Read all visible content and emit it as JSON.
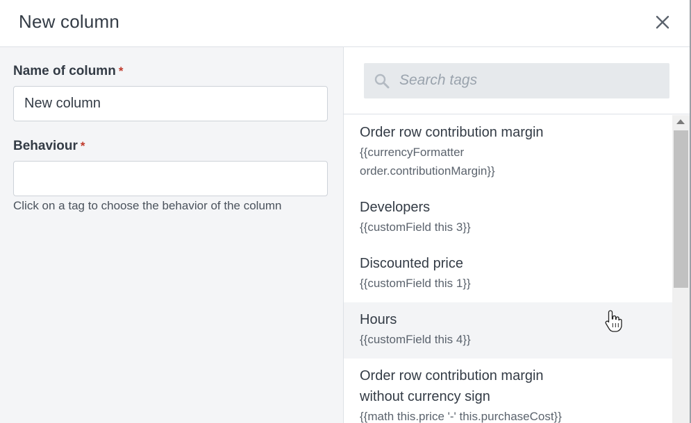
{
  "dialog": {
    "title": "New column",
    "close_icon": "close-icon"
  },
  "form": {
    "name_label": "Name of column",
    "name_required": "*",
    "name_value": "New column",
    "behaviour_label": "Behaviour",
    "behaviour_required": "*",
    "behaviour_value": "",
    "help_text": "Click on a tag to choose the behavior of the column"
  },
  "search": {
    "icon": "search-icon",
    "placeholder": "Search tags"
  },
  "tags": [
    {
      "name": "Order row contribution margin",
      "code_lines": [
        "{{currencyFormatter",
        "order.contributionMargin}}"
      ]
    },
    {
      "name": "Developers",
      "code_lines": [
        "{{customField this 3}}"
      ]
    },
    {
      "name": "Discounted price",
      "code_lines": [
        "{{customField this 1}}"
      ]
    },
    {
      "name": "Hours",
      "code_lines": [
        "{{customField this 4}}"
      ]
    },
    {
      "name": "Order row contribution margin without currency sign",
      "name_lines": [
        "Order row contribution margin",
        "without currency sign"
      ],
      "code_lines": [
        "{{math this.price '-' this.purchaseCost}}"
      ]
    }
  ],
  "colors": {
    "left_background": "#f4f5f7",
    "required_star": "#c0392b",
    "search_background": "#e6e9ec",
    "hover_row": "#f3f4f6"
  }
}
